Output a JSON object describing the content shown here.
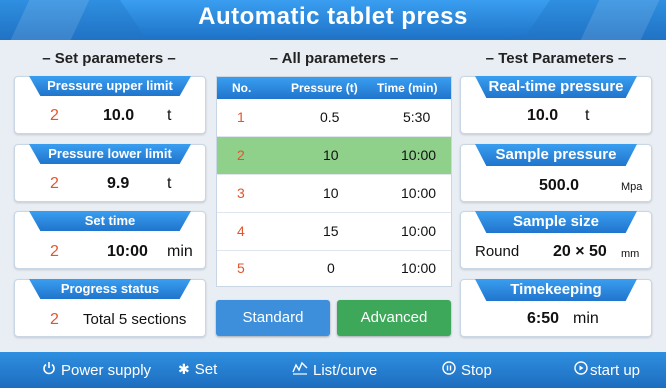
{
  "title": "Automatic tablet press",
  "sections": {
    "set": "Set parameters",
    "all": "All parameters",
    "test": "Test Parameters"
  },
  "set_cards": [
    {
      "label": "Pressure upper limit",
      "index": "2",
      "value": "10.0",
      "unit": "t"
    },
    {
      "label": "Pressure lower limit",
      "index": "2",
      "value": "9.9",
      "unit": "t"
    },
    {
      "label": "Set time",
      "index": "2",
      "value": "10:00",
      "unit": "min"
    },
    {
      "label": "Progress status",
      "index": "2",
      "value": "Total 5 sections",
      "unit": ""
    }
  ],
  "table": {
    "headers": [
      "No.",
      "Pressure (t)",
      "Time (min)"
    ],
    "rows": [
      {
        "no": "1",
        "pressure": "0.5",
        "time": "5:30",
        "selected": false
      },
      {
        "no": "2",
        "pressure": "10",
        "time": "10:00",
        "selected": true
      },
      {
        "no": "3",
        "pressure": "10",
        "time": "10:00",
        "selected": false
      },
      {
        "no": "4",
        "pressure": "15",
        "time": "10:00",
        "selected": false
      },
      {
        "no": "5",
        "pressure": "0",
        "time": "10:00",
        "selected": false
      }
    ]
  },
  "buttons": {
    "standard": "Standard",
    "advanced": "Advanced"
  },
  "test_cards": [
    {
      "label": "Real-time pressure",
      "value": "10.0",
      "unit": "t"
    },
    {
      "label": "Sample pressure",
      "value": "500.0",
      "unit": "Mpa"
    },
    {
      "label": "Sample size",
      "prefix": "Round",
      "value": "20 × 50",
      "unit": "mm"
    },
    {
      "label": "Timekeeping",
      "value": "6:50",
      "unit": "min"
    }
  ],
  "footer": {
    "power": "Power supply",
    "set": "Set",
    "list": "List/curve",
    "stop": "Stop",
    "start": "start up"
  },
  "colors": {
    "accent_blue": "#2a85d8",
    "standard_button": "#3d8fdc",
    "advanced_button": "#3ea85a",
    "selected_row": "#8fd18b",
    "index_red": "#e2552f"
  },
  "icons": [
    "power-icon",
    "gear-icon",
    "list-curve-icon",
    "stop-icon",
    "play-icon"
  ]
}
